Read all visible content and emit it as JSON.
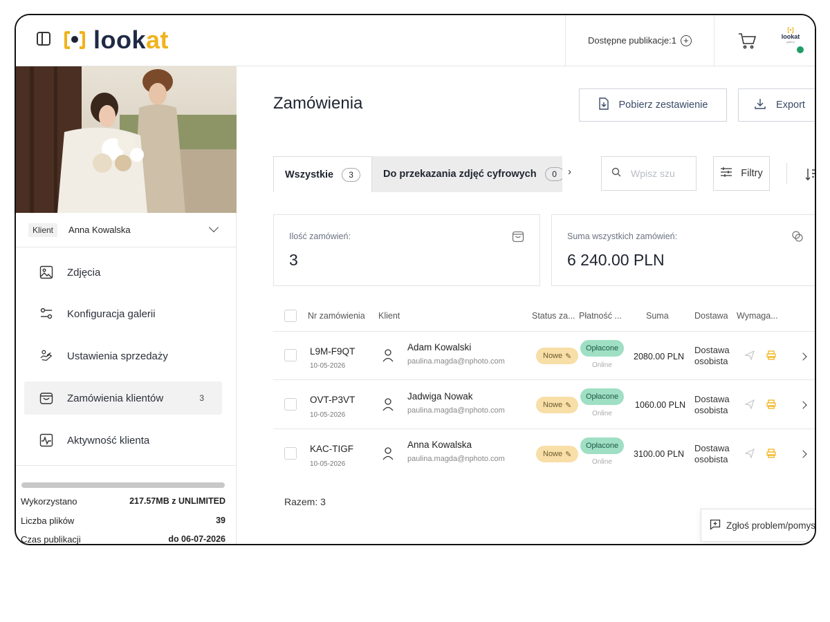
{
  "app": {
    "logo_text_main": "look",
    "logo_text_accent": "at",
    "mini_logo_text": "lookat",
    "mini_logo_sub": "gallery"
  },
  "topbar": {
    "available_publications": "Dostępne publikacje:1"
  },
  "sidebar": {
    "client_tag": "Klient",
    "client_name": "Anna Kowalska",
    "items": [
      {
        "label": "Zdjęcia",
        "icon": "image-icon"
      },
      {
        "label": "Konfiguracja galerii",
        "icon": "sliders-icon"
      },
      {
        "label": "Ustawienia sprzedaży",
        "icon": "hand-coin-icon"
      },
      {
        "label": "Zamówienia klientów",
        "icon": "shopping-bag-icon",
        "badge": "3",
        "active": true
      },
      {
        "label": "Aktywność klienta",
        "icon": "activity-icon"
      }
    ],
    "usage_label": "Wykorzystano",
    "usage_value": "217.57MB z UNLIMITED",
    "files_label": "Liczba plików",
    "files_value": "39",
    "publish_label": "Czas publikacji",
    "publish_value": "do 06-07-2026"
  },
  "main": {
    "title": "Zamówienia",
    "download_summary_label": "Pobierz zestawienie",
    "export_label": "Export",
    "tabs": [
      {
        "label": "Wszystkie",
        "count": "3"
      },
      {
        "label": "Do przekazania zdjęć cyfrowych",
        "count": "0"
      }
    ],
    "search_placeholder": "Wpisz szu",
    "filters_label": "Filtry",
    "cards": {
      "orders_count_label": "Ilość zamówień:",
      "orders_count_value": "3",
      "orders_sum_label": "Suma wszystkich zamówień:",
      "orders_sum_value": "6 240.00 PLN"
    },
    "table": {
      "headers": {
        "order_no": "Nr zamówienia",
        "client": "Klient",
        "status": "Status za...",
        "payment": "Płatność ...",
        "sum": "Suma",
        "delivery": "Dostawa",
        "required": "Wymaga..."
      },
      "rows": [
        {
          "order_no": "L9M-F9QT",
          "date": "10-05-2026",
          "client_name": "Adam Kowalski",
          "client_email": "paulina.magda@nphoto.com",
          "status": "Nowe",
          "payment": "Opłacone",
          "payment_method": "Online",
          "sum": "2080.00 PLN",
          "delivery_line1": "Dostawa",
          "delivery_line2": "osobista"
        },
        {
          "order_no": "OVT-P3VT",
          "date": "10-05-2026",
          "client_name": "Jadwiga Nowak",
          "client_email": "paulina.magda@nphoto.com",
          "status": "Nowe",
          "payment": "Opłacone",
          "payment_method": "Online",
          "sum": "1060.00 PLN",
          "delivery_line1": "Dostawa",
          "delivery_line2": "osobista"
        },
        {
          "order_no": "KAC-TIGF",
          "date": "10-05-2026",
          "client_name": "Anna Kowalska",
          "client_email": "paulina.magda@nphoto.com",
          "status": "Nowe",
          "payment": "Opłacone",
          "payment_method": "Online",
          "sum": "3100.00 PLN",
          "delivery_line1": "Dostawa",
          "delivery_line2": "osobista"
        }
      ],
      "total": "Razem: 3"
    },
    "report_problem_label": "Zgłoś problem/pomysł"
  },
  "colors": {
    "brand_yellow": "#f1b31c",
    "status_new": "#f8dea7",
    "status_paid": "#9fdfc4",
    "online_dot": "#1f9e67"
  }
}
